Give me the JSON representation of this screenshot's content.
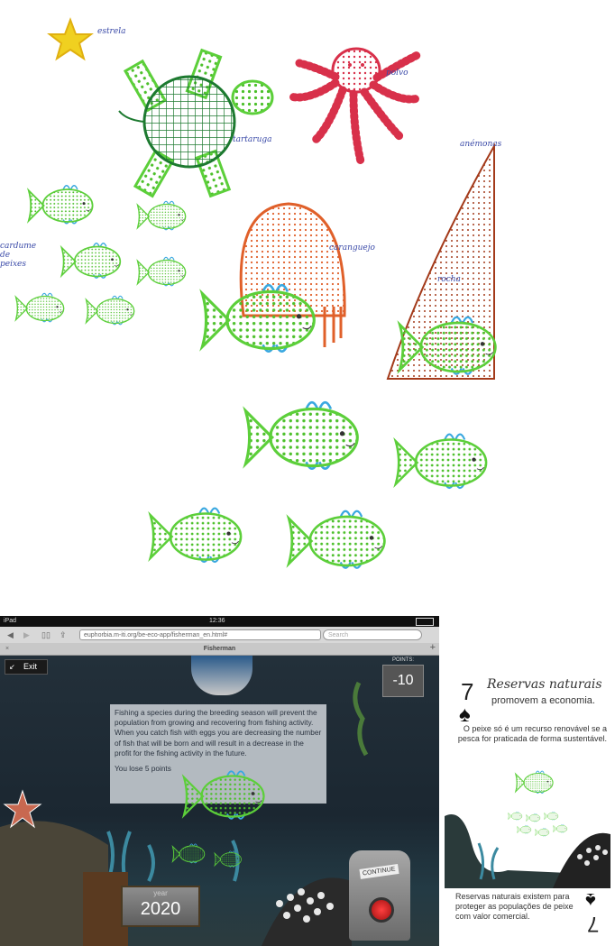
{
  "drawing": {
    "labels": {
      "star": "estrela",
      "octopus": "polvo",
      "turtle": "tartaruga",
      "anemone": "anémonas",
      "crab": "caranguejo",
      "school": "cardume de peixes",
      "rock": "rocha"
    }
  },
  "ipad": {
    "status": {
      "device": "iPad",
      "time": "12:36"
    },
    "browser": {
      "url": "euphorbia.m-iti.org/be-eco-app/fisherman_en.html#",
      "search_placeholder": "Search",
      "tab_title": "Fisherman",
      "close_tab": "×",
      "new_tab": "+"
    },
    "game": {
      "exit_label": "Exit",
      "points_label": "POINTS:",
      "points_value": "-10",
      "message": "Fishing a species during the breeding season will prevent the population from growing and recovering from fishing activity. When you catch fish with eggs you are decreasing the number of fish that will be born and will result in a decrease in the profit for the fishing activity in the future.",
      "penalty": "You lose 5 points",
      "year_label": "year",
      "year_value": "2020",
      "continue_label": "CONTINUE"
    }
  },
  "card": {
    "rank": "7",
    "suit": "♠",
    "title": "Reservas naturais",
    "subtitle": "promovem a economia.",
    "body": "O peixe só é um recurso renovável se a pesca for praticada de forma sustentável.",
    "footer": "Reservas naturais existem para proteger as populações de peixe com valor comercial."
  },
  "colors": {
    "fish_green": "#5ccf3a",
    "fish_blue": "#3aa8e0",
    "turtle_green": "#2e9a3a",
    "octopus_red": "#d8304a",
    "crab_orange": "#e0602a",
    "anemone_brown": "#a33a1a",
    "star_yellow": "#f0d020"
  }
}
